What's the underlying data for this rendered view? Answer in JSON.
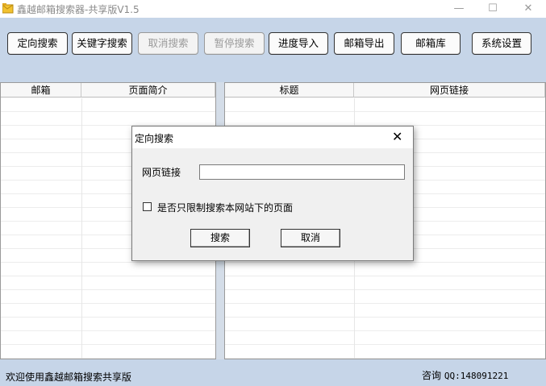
{
  "window": {
    "title": "鑫越邮箱搜索器-共享版V1.5",
    "minimize_glyph": "—",
    "maximize_glyph": "☐",
    "close_glyph": "✕"
  },
  "toolbar": {
    "buttons": [
      {
        "label": "定向搜索",
        "enabled": true
      },
      {
        "label": "关键字搜索",
        "enabled": true
      },
      {
        "label": "取消搜索",
        "enabled": false
      },
      {
        "label": "暂停搜索",
        "enabled": false
      },
      {
        "label": "进度导入",
        "enabled": true
      },
      {
        "label": "邮箱导出",
        "enabled": true
      },
      {
        "label": "邮箱库",
        "enabled": true
      },
      {
        "label": "系统设置",
        "enabled": true
      }
    ]
  },
  "left_table": {
    "columns": [
      "邮箱",
      "页面简介"
    ]
  },
  "right_table": {
    "columns": [
      "标题",
      "网页链接"
    ]
  },
  "status": {
    "left": "欢迎使用鑫越邮箱搜索共享版",
    "consult_label": "咨询",
    "qq": "QQ:148091221"
  },
  "dialog": {
    "title": "定向搜索",
    "close_glyph": "✕",
    "url_label": "网页链接",
    "url_value": "",
    "checkbox_label": "是否只限制搜索本网站下的页面",
    "checkbox_checked": false,
    "search_button": "搜索",
    "cancel_button": "取消"
  },
  "colors": {
    "toolbar_bg": "#c6d5e8",
    "statusbar_bg": "#c6d5e8",
    "icon_yellow": "#f2c230"
  }
}
